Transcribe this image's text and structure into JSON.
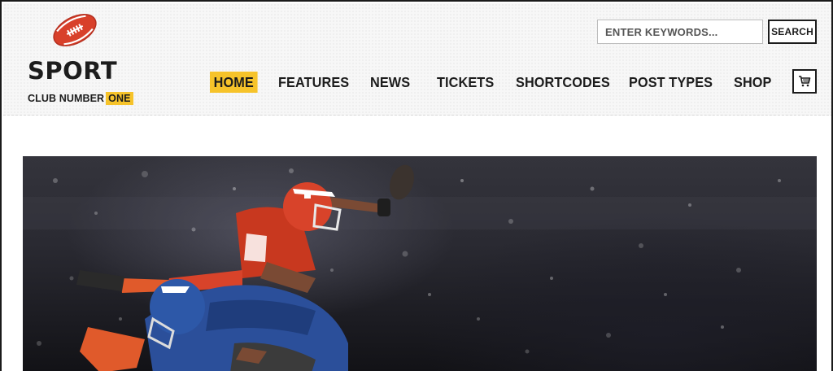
{
  "brand": {
    "name": "SPORT",
    "tagline": "CLUB NUMBER",
    "tagline_highlight": "ONE",
    "logo_icon": "football-icon",
    "accent_color": "#f6c32a"
  },
  "search": {
    "placeholder": "ENTER KEYWORDS...",
    "button_label": "SEARCH"
  },
  "nav": {
    "items": [
      {
        "label": "HOME",
        "active": true
      },
      {
        "label": "FEATURES",
        "active": false
      },
      {
        "label": "NEWS",
        "active": false
      },
      {
        "label": "TICKETS",
        "active": false
      },
      {
        "label": "SHORTCODES",
        "active": false
      },
      {
        "label": "POST TYPES",
        "active": false
      },
      {
        "label": "SHOP",
        "active": false
      }
    ],
    "cart_icon": "shopping-cart-icon"
  },
  "hero": {
    "image": "american-football-players-tackle-photo"
  }
}
